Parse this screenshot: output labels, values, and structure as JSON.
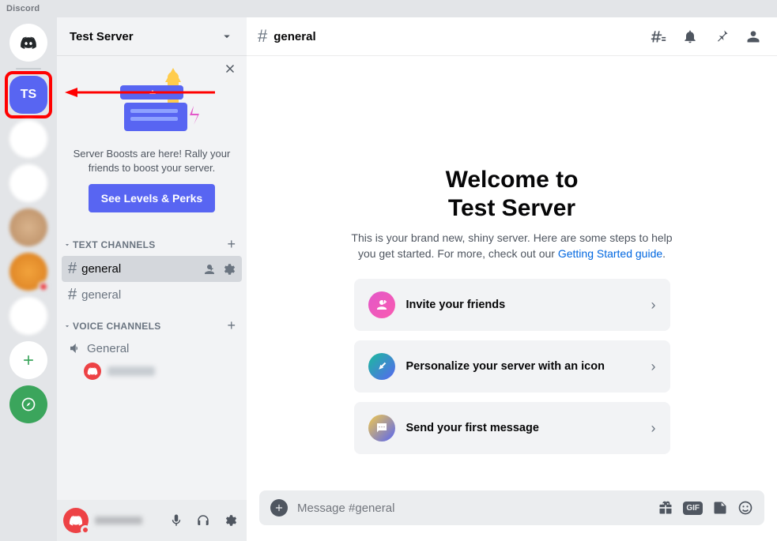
{
  "app_name": "Discord",
  "server_rail": {
    "active_server_abbrev": "TS"
  },
  "sidebar": {
    "server_name": "Test Server",
    "boost": {
      "text": "Server Boosts are here! Rally your friends to boost your server.",
      "button": "See Levels & Perks"
    },
    "categories": {
      "text_label": "TEXT CHANNELS",
      "voice_label": "VOICE CHANNELS"
    },
    "text_channels": [
      {
        "name": "general",
        "active": true
      },
      {
        "name": "general",
        "active": false
      }
    ],
    "voice_channels": [
      {
        "name": "General"
      }
    ]
  },
  "header": {
    "channel_name": "general"
  },
  "welcome": {
    "title_line1": "Welcome to",
    "title_line2": "Test Server",
    "subtitle_pre": "This is your brand new, shiny server. Here are some steps to help you get started. For more, check out our ",
    "subtitle_link": "Getting Started guide",
    "subtitle_post": ".",
    "cards": [
      {
        "label": "Invite your friends"
      },
      {
        "label": "Personalize your server with an icon"
      },
      {
        "label": "Send your first message"
      }
    ]
  },
  "composer": {
    "placeholder": "Message #general",
    "gif_label": "GIF"
  }
}
